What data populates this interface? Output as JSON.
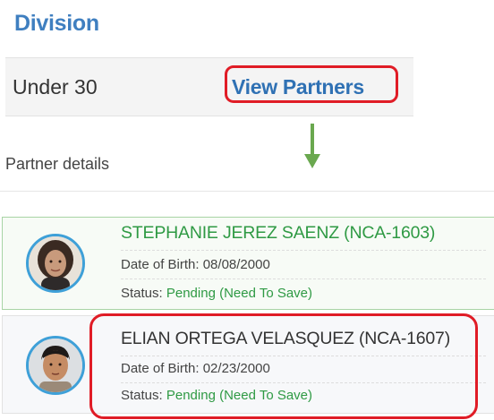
{
  "division": {
    "heading": "Division",
    "value": "Under 30",
    "view_partners_label": "View Partners"
  },
  "partner_details": {
    "label": "Partner details"
  },
  "partners": [
    {
      "name": "STEPHANIE JEREZ SAENZ (NCA-1603)",
      "dob_label": "Date of Birth: ",
      "dob": "08/08/2000",
      "status_label": "Status: ",
      "status": "Pending (Need To Save)"
    },
    {
      "name": "ELIAN ORTEGA VELASQUEZ (NCA-1607)",
      "dob_label": "Date of Birth: ",
      "dob": "02/23/2000",
      "status_label": "Status: ",
      "status": "Pending (Need To Save)"
    }
  ],
  "icons": {
    "arrow": "down-arrow-icon",
    "avatar": "avatar"
  },
  "colors": {
    "heading_blue": "#3f7fc0",
    "link_blue": "#2f71b4",
    "highlight_red": "#e01c26",
    "status_green": "#2f9a44",
    "arrow_green": "#6aa84f",
    "avatar_ring": "#3ea0d8"
  }
}
